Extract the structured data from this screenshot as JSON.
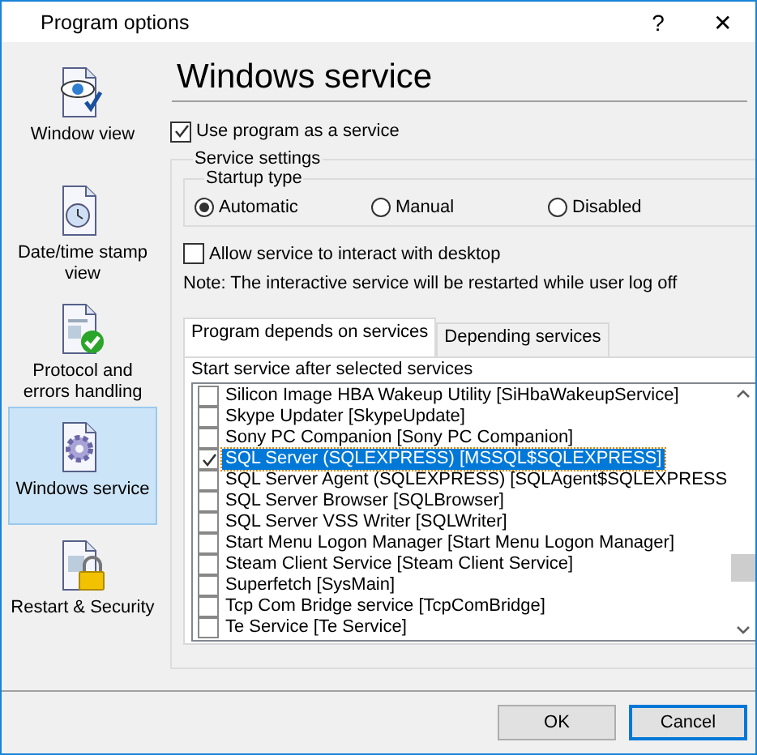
{
  "window": {
    "title": "Program options",
    "help": "?",
    "close": "✕"
  },
  "sidebar": {
    "items": [
      {
        "label": "Window view",
        "selected": false
      },
      {
        "label": "Date/time stamp view",
        "selected": false
      },
      {
        "label": "Protocol and errors handling",
        "selected": false
      },
      {
        "label": "Windows service",
        "selected": true
      },
      {
        "label": "Restart & Security",
        "selected": false
      }
    ]
  },
  "page": {
    "title": "Windows service",
    "use_as_service": {
      "label": "Use program as a service",
      "checked": true
    },
    "service_settings": {
      "title": "Service settings",
      "startup_type": {
        "title": "Startup type",
        "options": [
          {
            "label": "Automatic",
            "selected": true
          },
          {
            "label": "Manual",
            "selected": false
          },
          {
            "label": "Disabled",
            "selected": false
          }
        ]
      },
      "allow_interact": {
        "label": "Allow service to interact with desktop",
        "checked": false
      },
      "note": "Note: The interactive service will be restarted while user log off",
      "tabs": [
        {
          "label": "Program depends on services",
          "selected": true
        },
        {
          "label": "Depending services",
          "selected": false
        }
      ],
      "list_caption": "Start service after selected services",
      "services": [
        {
          "label": "Silicon Image HBA Wakeup Utility [SiHbaWakeupService]",
          "checked": false,
          "selected": false
        },
        {
          "label": "Skype Updater [SkypeUpdate]",
          "checked": false,
          "selected": false
        },
        {
          "label": "Sony PC Companion [Sony PC Companion]",
          "checked": false,
          "selected": false
        },
        {
          "label": "SQL Server (SQLEXPRESS) [MSSQL$SQLEXPRESS]",
          "checked": true,
          "selected": true
        },
        {
          "label": "SQL Server Agent (SQLEXPRESS) [SQLAgent$SQLEXPRESS",
          "checked": false,
          "selected": false
        },
        {
          "label": "SQL Server Browser [SQLBrowser]",
          "checked": false,
          "selected": false
        },
        {
          "label": "SQL Server VSS Writer [SQLWriter]",
          "checked": false,
          "selected": false
        },
        {
          "label": "Start Menu Logon Manager [Start Menu Logon Manager]",
          "checked": false,
          "selected": false
        },
        {
          "label": "Steam Client Service [Steam Client Service]",
          "checked": false,
          "selected": false
        },
        {
          "label": "Superfetch [SysMain]",
          "checked": false,
          "selected": false
        },
        {
          "label": "Tcp Com Bridge service [TcpComBridge]",
          "checked": false,
          "selected": false
        },
        {
          "label": "Te Service [Te Service]",
          "checked": false,
          "selected": false
        }
      ]
    }
  },
  "buttons": [
    {
      "label": "OK",
      "default": false
    },
    {
      "label": "Cancel",
      "default": true
    }
  ]
}
